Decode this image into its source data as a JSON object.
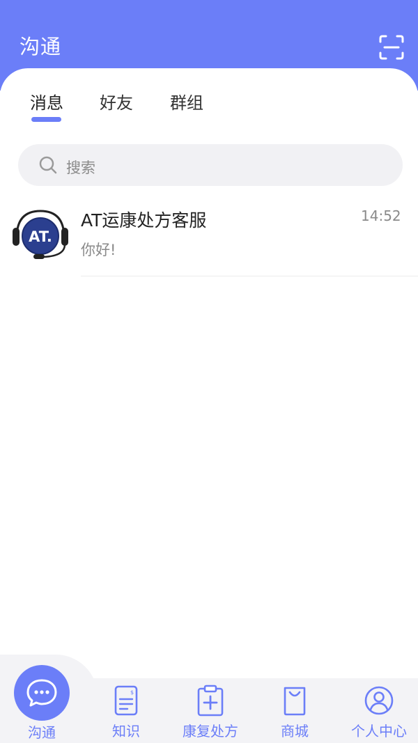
{
  "header": {
    "title": "沟通",
    "scan_icon": "scan-icon"
  },
  "tabs": [
    {
      "label": "消息",
      "active": true
    },
    {
      "label": "好友",
      "active": false
    },
    {
      "label": "群组",
      "active": false
    }
  ],
  "search": {
    "placeholder": "搜索"
  },
  "conversations": [
    {
      "name": "AT运康处方客服",
      "time": "14:52",
      "last_message": "你好!",
      "avatar_text": "AT."
    }
  ],
  "bottom_nav": [
    {
      "label": "沟通",
      "icon": "chat-bubble-icon",
      "active": true
    },
    {
      "label": "知识",
      "icon": "document-icon",
      "active": false
    },
    {
      "label": "康复处方",
      "icon": "clipboard-plus-icon",
      "active": false
    },
    {
      "label": "商城",
      "icon": "shopping-bag-icon",
      "active": false
    },
    {
      "label": "个人中心",
      "icon": "user-icon",
      "active": false
    }
  ],
  "colors": {
    "primary": "#6b7ef8",
    "text": "#222222",
    "muted": "#8a8a8a"
  }
}
